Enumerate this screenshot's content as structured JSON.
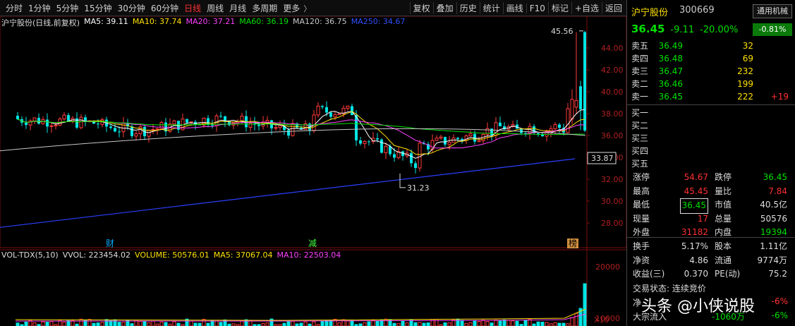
{
  "toolbar": {
    "periods": [
      "分时",
      "1分钟",
      "5分钟",
      "15分钟",
      "30分钟",
      "60分钟",
      "日线",
      "周线",
      "月线",
      "多周期",
      "更多"
    ],
    "active_period": "日线",
    "more_icon": "chevron-right-icon",
    "tools": [
      "复权",
      "叠加",
      "历史",
      "统计",
      "画线",
      "F10",
      "标记",
      "+自选",
      "返回"
    ]
  },
  "main_chart": {
    "legend_name": "沪宁股份(日线,前复权)",
    "ma": [
      {
        "label": "MA5: 39.11",
        "color": "#ffffff"
      },
      {
        "label": "MA10: 37.74",
        "color": "#ffe000"
      },
      {
        "label": "MA20: 37.21",
        "color": "#ff40ff"
      },
      {
        "label": "MA60: 36.19",
        "color": "#00e000"
      },
      {
        "label": "MA120: 36.75",
        "color": "#c8c8c8"
      },
      {
        "label": "MA250: 34.67",
        "color": "#3050ff"
      }
    ],
    "y_ticks": [
      "44.00",
      "42.00",
      "40.00",
      "38.00",
      "36.00",
      "34.00",
      "32.00",
      "30.00",
      "28.00"
    ],
    "current_line_label": "33.87",
    "high_marker": "45.56",
    "low_marker": "31.23",
    "event_markers": [
      {
        "text": "财",
        "color": "#00aaff"
      },
      {
        "text": "减",
        "color": "#40ff40"
      },
      {
        "text": "榜",
        "color": "#ffffff"
      }
    ]
  },
  "volume_chart": {
    "legend": [
      {
        "label": "VOL-TDX(5,10)",
        "color": "#dddddd"
      },
      {
        "label": "VVOL: 223454.02",
        "color": "#dddddd"
      },
      {
        "label": "VOLUME: 50576.01",
        "color": "#ffe000"
      },
      {
        "label": "MA5: 37067.04",
        "color": "#ffe000"
      },
      {
        "label": "MA10: 22503.04",
        "color": "#ff40ff"
      }
    ],
    "y_ticks": [
      "20000",
      "10000"
    ],
    "unit": "X10"
  },
  "quote": {
    "name": "沪宁股份",
    "code": "300669",
    "sector": "通用机械",
    "sector_change": "-0.81%",
    "price": "36.45",
    "change": "-9.11",
    "change_pct": "-20.00%"
  },
  "orderbook": {
    "asks": [
      {
        "label": "卖五",
        "price": "36.49",
        "vol": "32",
        "delta": ""
      },
      {
        "label": "卖四",
        "price": "36.48",
        "vol": "69",
        "delta": ""
      },
      {
        "label": "卖三",
        "price": "36.47",
        "vol": "232",
        "delta": ""
      },
      {
        "label": "卖二",
        "price": "36.46",
        "vol": "199",
        "delta": ""
      },
      {
        "label": "卖一",
        "price": "36.45",
        "vol": "222",
        "delta": "+19"
      }
    ],
    "bids": [
      {
        "label": "买一"
      },
      {
        "label": "买二"
      },
      {
        "label": "买三"
      },
      {
        "label": "买四"
      },
      {
        "label": "买五"
      }
    ]
  },
  "stats": [
    {
      "l1": "涨停",
      "v1": "54.67",
      "c1": "red",
      "l2": "跌停",
      "v2": "36.45",
      "c2": "green"
    },
    {
      "l1": "最高",
      "v1": "45.45",
      "c1": "red",
      "l2": "量比",
      "v2": "7.84",
      "c2": "red"
    },
    {
      "l1": "最低",
      "v1": "36.45",
      "c1": "green",
      "l2": "市值",
      "v2": "40.5亿",
      "c2": "white"
    },
    {
      "l1": "现量",
      "v1": "17",
      "c1": "red",
      "l2": "总量",
      "v2": "50576",
      "c2": "white"
    },
    {
      "l1": "外盘",
      "v1": "31182",
      "c1": "red",
      "l2": "内盘",
      "v2": "19394",
      "c2": "green"
    }
  ],
  "fund": [
    {
      "l1": "换手",
      "v1": "5.17%",
      "c1": "white",
      "l2": "股本",
      "v2": "1.11亿",
      "c2": "white"
    },
    {
      "l1": "净资",
      "v1": "4.86",
      "c1": "white",
      "l2": "流通",
      "v2": "9774万",
      "c2": "white"
    },
    {
      "l1": "收益(三)",
      "v1": "0.370",
      "c1": "white",
      "l2": "PE(动)",
      "v2": "75.2",
      "c2": "white"
    }
  ],
  "trade_state": "交易状态: 连续竞价",
  "bottom": {
    "row1_label": "净",
    "row1_value": "-6%",
    "row2_label": "大宗流入",
    "row2_value": "-1060万",
    "row2_pct": "-6%"
  },
  "watermark": "头条 @小侠说股"
}
